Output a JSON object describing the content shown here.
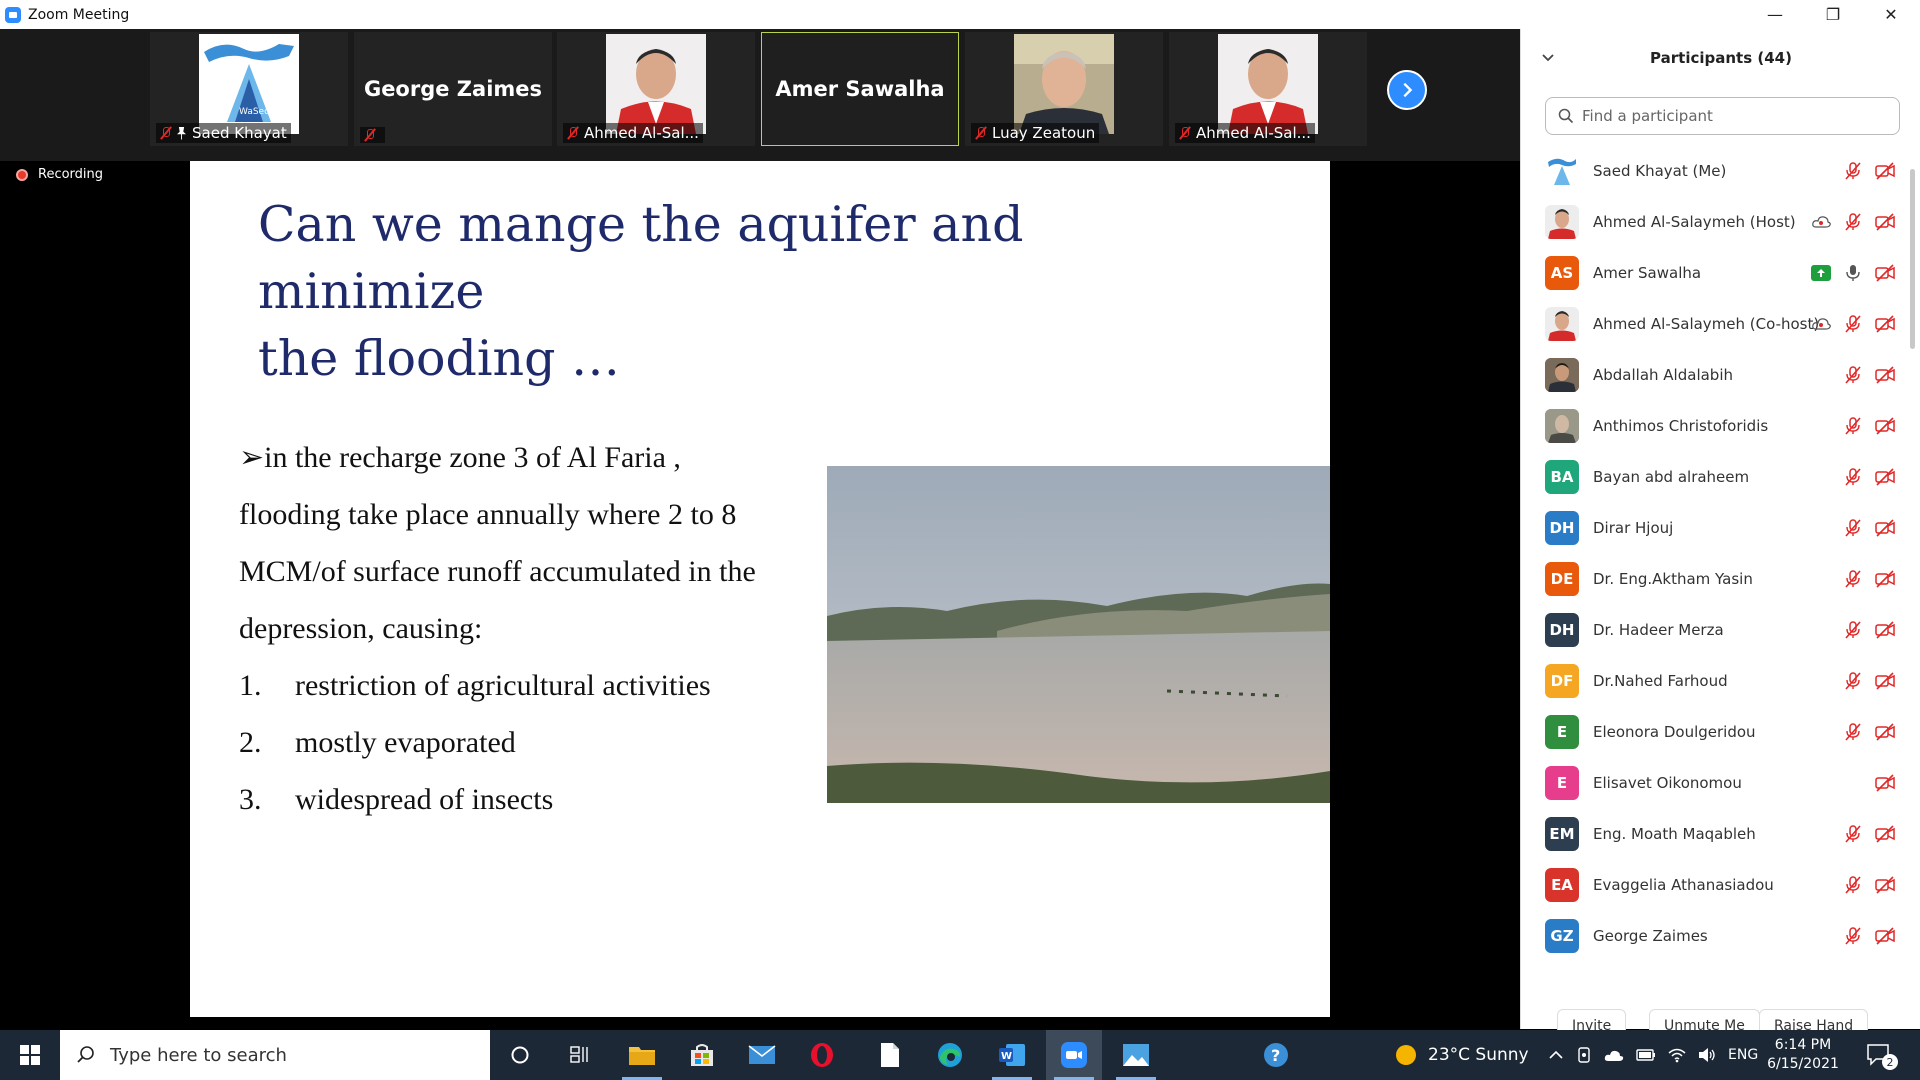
{
  "window": {
    "title": "Zoom Meeting"
  },
  "video_strip": {
    "tiles": [
      {
        "name": "Saed Khayat",
        "pinned": true
      },
      {
        "name": "George Zaimes",
        "display_name": "George Zaimes"
      },
      {
        "name": "Ahmed Al-Sal..."
      },
      {
        "name": "Amer Sawalha",
        "display_name": "Amer Sawalha",
        "active_speaker": true
      },
      {
        "name": "Luay Zeatoun"
      },
      {
        "name": "Ahmed Al-Sal..."
      }
    ]
  },
  "recording": {
    "label": "Recording"
  },
  "slide": {
    "title_line1": "Can we mange the aquifer and minimize",
    "title_line2": "the flooding  …",
    "bullet_marker": "➢",
    "para_line1": "in the recharge  zone 3 of Al Faria ,",
    "para_line2": "flooding take place  annually  where  2 to 8",
    "para_line3": "MCM/of surface runoff accumulated  in the",
    "para_line4": "depression, causing:",
    "items": [
      {
        "num": "1.",
        "text": "restriction of agricultural  activities"
      },
      {
        "num": "2.",
        "text": "mostly evaporated"
      },
      {
        "num": "3.",
        "text": "widespread of  insects"
      }
    ]
  },
  "participants": {
    "title": "Participants (44)",
    "search_placeholder": "Find a participant",
    "list": [
      {
        "name": "Saed Khayat (Me)",
        "initials": "",
        "color": "#ffffff"
      },
      {
        "name": "Ahmed Al-Salaymeh (Host)",
        "initials": "",
        "color": "#ffffff"
      },
      {
        "name": "Amer Sawalha",
        "initials": "AS",
        "color": "#e8590c"
      },
      {
        "name": "Ahmed Al-Salaymeh (Co-host)",
        "initials": "",
        "color": "#ffffff"
      },
      {
        "name": "Abdallah Aldalabih",
        "initials": "",
        "color": "#6b5a4a"
      },
      {
        "name": "Anthimos Christoforidis",
        "initials": "",
        "color": "#8a8a7a"
      },
      {
        "name": "Bayan abd  alraheem",
        "initials": "BA",
        "color": "#1fa67a"
      },
      {
        "name": "Dirar Hjouj",
        "initials": "DH",
        "color": "#2a7cc7"
      },
      {
        "name": "Dr. Eng.Aktham Yasin",
        "initials": "DE",
        "color": "#e8590c"
      },
      {
        "name": "Dr. Hadeer Merza",
        "initials": "DH",
        "color": "#2d3e50"
      },
      {
        "name": "Dr.Nahed Farhoud",
        "initials": "DF",
        "color": "#f5a623"
      },
      {
        "name": "Eleonora Doulgeridou",
        "initials": "E",
        "color": "#2f8f3f"
      },
      {
        "name": "Elisavet Oikonomou",
        "initials": "E",
        "color": "#e63e8c"
      },
      {
        "name": "Eng. Moath Maqableh",
        "initials": "EM",
        "color": "#2d3e50"
      },
      {
        "name": "Evaggelia Athanasiadou",
        "initials": "EA",
        "color": "#d9342b"
      },
      {
        "name": "George Zaimes",
        "initials": "GZ",
        "color": "#2a7cc7"
      }
    ],
    "buttons": {
      "invite": "Invite",
      "unmute": "Unmute Me",
      "raise_hand": "Raise Hand"
    }
  },
  "taskbar": {
    "search_placeholder": "Type here to search",
    "weather": "23°C  Sunny",
    "language": "ENG",
    "time": "6:14 PM",
    "date": "6/15/2021",
    "notifications": "2"
  },
  "colors": {
    "zoom_blue": "#2D8CFF",
    "slide_title": "#1f2a6b",
    "recording_red": "#e8392b",
    "mic_off_red": "#e02828"
  }
}
